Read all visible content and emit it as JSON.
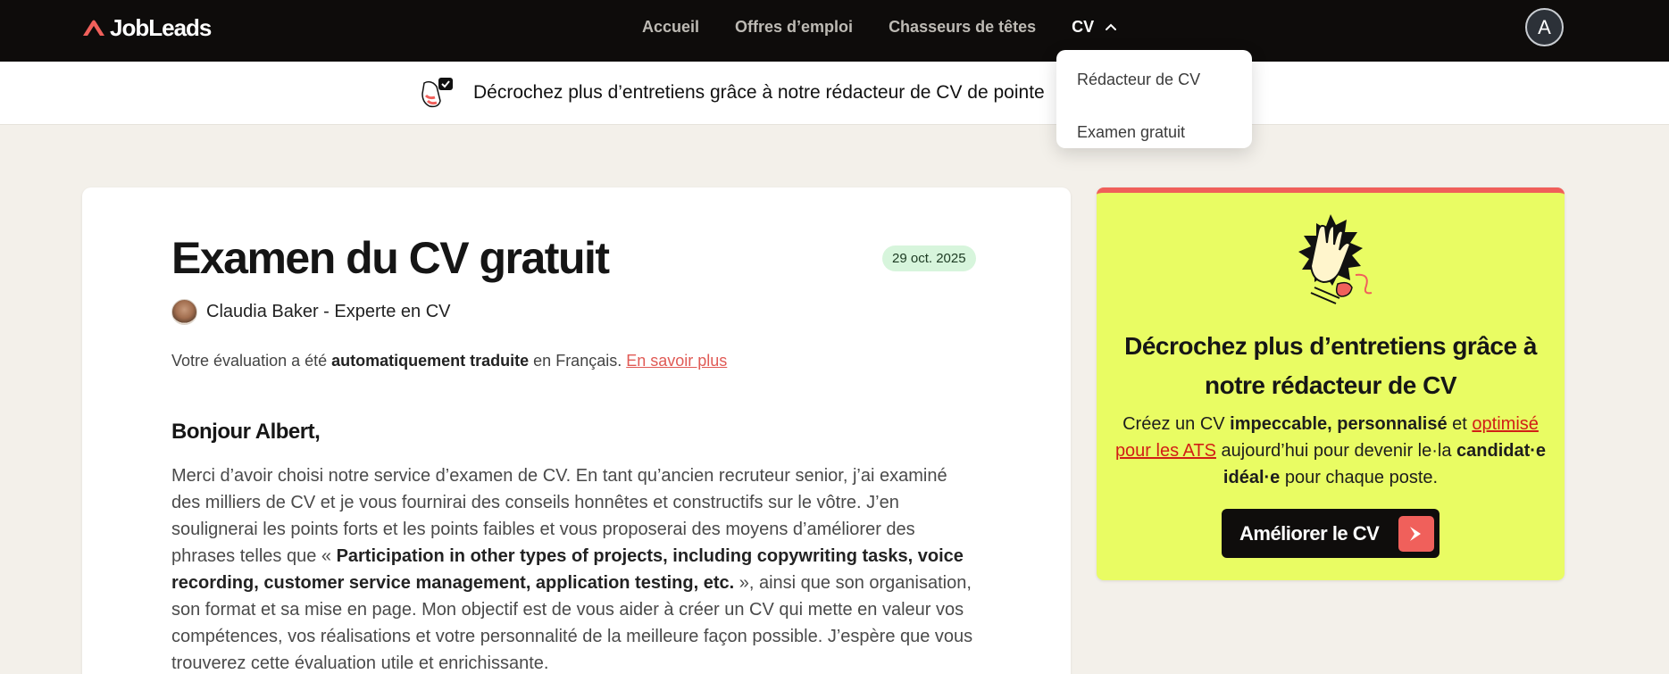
{
  "nav": {
    "logo": "JobLeads",
    "links": [
      "Accueil",
      "Offres d’emploi",
      "Chasseurs de têtes"
    ],
    "active": "CV",
    "avatar_initial": "A"
  },
  "dropdown": {
    "items": [
      "Rédacteur de CV",
      "Examen gratuit"
    ]
  },
  "banner": {
    "text": "Décrochez plus d’entretiens grâce à notre rédacteur de CV de pointe"
  },
  "main": {
    "title": "Examen du CV gratuit",
    "date": "29 oct. 2025",
    "author_name": "Claudia Baker",
    "author_role": "Experte en CV",
    "translate_prefix": "Votre évaluation a été ",
    "translate_bold": "automatiquement traduite",
    "translate_suffix": " en Français. ",
    "translate_link": "En savoir plus",
    "greeting": "Bonjour Albert,",
    "body_part1": "Merci d’avoir choisi notre service d’examen de CV. En tant qu’ancien recruteur senior, j’ai examiné des milliers de CV et je vous fournirai des conseils honnêtes et constructifs sur le vôtre. J’en soulignerai les points forts et les points faibles et vous proposerai des moyens d’améliorer des phrases telles que « ",
    "body_bold": "Participation in other types of projects, including copywriting tasks, voice recording, customer service management, application testing, etc.",
    "body_part2": " », ainsi que son organisation, son format et sa mise en page. Mon objectif est de vous aider à créer un CV qui mette en valeur vos compétences, vos réalisations et votre personnalité de la meilleure façon possible. J’espère que vous trouverez cette évaluation utile et enrichissante."
  },
  "side": {
    "title": "Décrochez plus d’entretiens grâce à notre rédacteur de CV",
    "text_1": "Créez un CV ",
    "text_bold_1": "impeccable, personnalisé",
    "text_2": " et ",
    "text_link": "optimisé pour les ATS",
    "text_3": " aujourd’hui pour devenir le·la ",
    "text_bold_2": "candidat·e idéal·e",
    "text_4": " pour chaque poste.",
    "cta": "Améliorer le CV"
  },
  "colors": {
    "nav_bg": "#0e0c0b",
    "accent": "#f0605b",
    "side_bg": "#e9fc63",
    "date_badge": "#d7f5dc"
  }
}
